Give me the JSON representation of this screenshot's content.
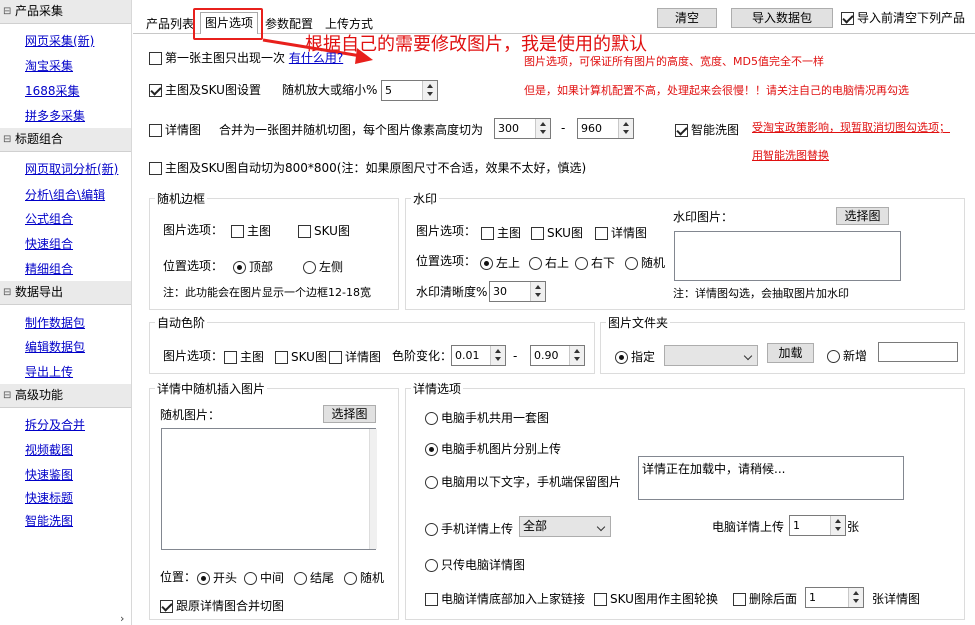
{
  "sidebar": {
    "sections": [
      {
        "title": "产品采集",
        "items": [
          "网页采集(新)",
          "淘宝采集",
          "1688采集",
          "拼多多采集"
        ]
      },
      {
        "title": "标题组合",
        "items": [
          "网页取词分析(新)",
          "分析\\组合\\编辑",
          "公式组合",
          "快速组合",
          "精细组合"
        ]
      },
      {
        "title": "数据导出",
        "items": [
          "制作数据包",
          "编辑数据包",
          "导出上传"
        ]
      },
      {
        "title": "高级功能",
        "items": [
          "拆分及合并",
          "视频截图",
          "快速鉴图",
          "快速标题",
          "智能洗图"
        ]
      }
    ],
    "expand_glyph": "⊟"
  },
  "tabs": [
    "产品列表",
    "图片选项",
    "参数配置",
    "上传方式"
  ],
  "toolbar": {
    "clear": "清空",
    "import": "导入数据包",
    "clear_before": "导入前清空下列产品"
  },
  "annotation": "根据自己的需要修改图片，我是使用的默认",
  "opt": {
    "first_once": "第一张主图只出现一次",
    "first_link": "有什么用?",
    "main_sku": "主图及SKU图设置",
    "zoom_label": "随机放大或缩小%",
    "zoom_val": "5",
    "note1": "图片选项，可保证所有图片的高度、宽度、MD5值完全不一样",
    "note2": "但是，如果计算机配置不高，处理起来会很慢！！请关注自己的电脑情况再勾选",
    "detail": "详情图",
    "merge_label": "合并为一张图并随机切图，每个图片像素高度切为",
    "h_min": "300",
    "dash": "-",
    "h_max": "960",
    "smart": "智能洗图",
    "note3": "受淘宝政策影响，现暂取消切图勾选项；",
    "note4": "用智能洗图替换",
    "auto800": "主图及SKU图自动切为800*800(注：如果原图尺寸不合适，效果不太好，慎选)"
  },
  "border": {
    "title": "随机边框",
    "img_label": "图片选项：",
    "main": "主图",
    "sku": "SKU图",
    "pos_label": "位置选项：",
    "top": "顶部",
    "left": "左侧",
    "note": "注：此功能会在图片显示一个边框12-18宽"
  },
  "watermark": {
    "title": "水印",
    "img_label": "图片选项：",
    "main": "主图",
    "sku": "SKU图",
    "detail": "详情图",
    "pos_label": "位置选项：",
    "tl": "左上",
    "tr": "右上",
    "br": "右下",
    "rand": "随机",
    "clarity_label": "水印清晰度%",
    "clarity_val": "30",
    "img_title": "水印图片：",
    "choose": "选择图",
    "note": "注：详情图勾选，会抽取图片加水印"
  },
  "color": {
    "title": "自动色阶",
    "img_label": "图片选项：",
    "main": "主图",
    "sku": "SKU图",
    "detail": "详情图",
    "change_label": "色阶变化：",
    "v1": "0.01",
    "dash": "-",
    "v2": "0.90"
  },
  "folder": {
    "title": "图片文件夹",
    "specify": "指定",
    "load": "加载",
    "new": "新增"
  },
  "insert": {
    "title": "详情中随机插入图片",
    "rand_label": "随机图片：",
    "choose": "选择图",
    "pos_label": "位置：",
    "p1": "开头",
    "p2": "中间",
    "p3": "结尾",
    "p4": "随机",
    "merge": "跟原详情图合并切图"
  },
  "detail": {
    "title": "详情选项",
    "o1": "电脑手机共用一套图",
    "o2": "电脑手机图片分别上传",
    "o3": "电脑用以下文字，手机端保留图片",
    "loading": "详情正在加载中，请稍候...",
    "o4": "手机详情上传",
    "o4_sel": "全部",
    "pc_label": "电脑详情上传",
    "pc_val": "1",
    "unit": "张",
    "o5": "只传电脑详情图",
    "c1": "电脑详情底部加入上家链接",
    "c2": "SKU图用作主图轮换",
    "c3": "删除后面",
    "del_val": "1",
    "del_unit": "张详情图"
  },
  "colors": {
    "link": "#0000c8",
    "red": "#e01010",
    "highlight": "#e8201c"
  }
}
